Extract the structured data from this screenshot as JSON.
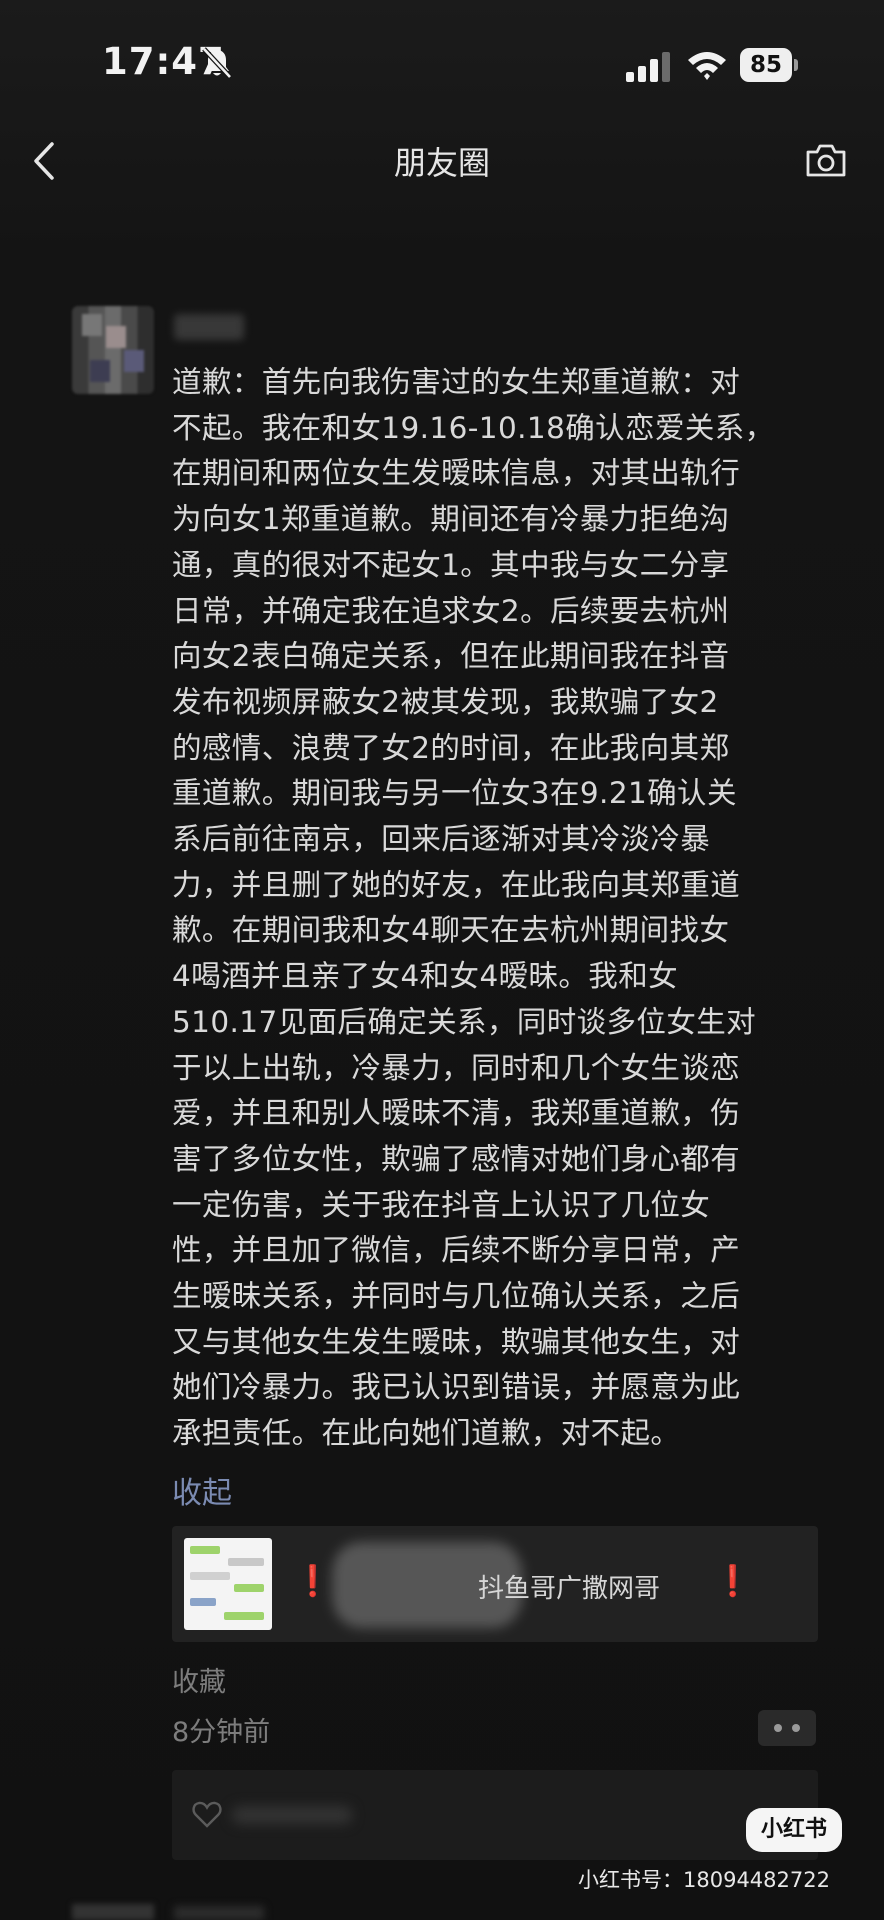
{
  "status_bar": {
    "time": "17:47",
    "battery": "85"
  },
  "nav": {
    "title": "朋友圈"
  },
  "post": {
    "username": "",
    "lines": [
      "道歉：首先向我伤害过的女生郑重道歉：对",
      "不起。我在和女19.16-10.18确认恋爱关系，",
      "在期间和两位女生发暧昧信息，对其出轨行",
      "为向女1郑重道歉。期间还有冷暴力拒绝沟",
      "通，真的很对不起女1。其中我与女二分享",
      "日常，并确定我在追求女2。后续要去杭州",
      "向女2表白确定关系，但在此期间我在抖音",
      "发布视频屏蔽女2被其发现，我欺骗了女2",
      "的感情、浪费了女2的时间，在此我向其郑",
      "重道歉。期间我与另一位女3在9.21确认关",
      "系后前往南京，回来后逐渐对其冷淡冷暴",
      "力，并且删了她的好友，在此我向其郑重道",
      "歉。在期间我和女4聊天在去杭州期间找女",
      "4喝酒并且亲了女4和女4暧昧。我和女",
      "510.17见面后确定关系，同时谈多位女生对",
      "于以上出轨，冷暴力，同时和几个女生谈恋",
      "爱，并且和别人暧昧不清，我郑重道歉，伤",
      "害了多位女性，欺骗了感情对她们身心都有",
      "一定伤害，关于我在抖音上认识了几位女",
      "性，并且加了微信，后续不断分享日常，产",
      "生暧昧关系，并同时与几位确认关系，之后",
      "又与其他女生发生暧昧，欺骗其他女生，对",
      "她们冷暴力。我已认识到错误，并愿意为此",
      "承担责任。在此向她们道歉，对不起。"
    ],
    "collapse_label": "收起",
    "share_card": {
      "mark_left": "❗",
      "title": "抖鱼哥广撒网哥",
      "mark_right": "❗"
    },
    "favorite_label": "收藏",
    "time_ago": "8分钟前"
  },
  "watermark": {
    "badge": "小红书",
    "id_text": "小红书号：18094482722"
  },
  "colors": {
    "background": "#151515",
    "link": "#7b8bb2",
    "alert_red": "#e02424"
  },
  "icons": [
    "bell-muted-icon",
    "signal-icon",
    "wifi-icon",
    "back-icon",
    "camera-icon",
    "heart-icon"
  ]
}
